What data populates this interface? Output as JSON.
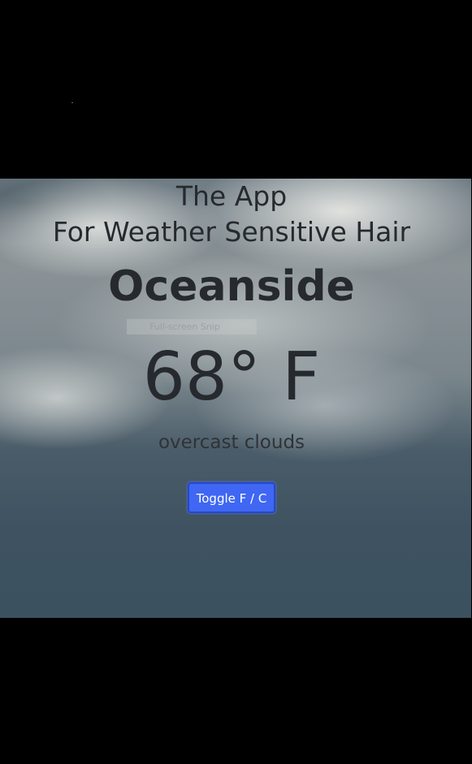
{
  "header": {
    "line1": "The App",
    "line2": "For Weather Sensitive Hair"
  },
  "weather": {
    "city": "Oceanside",
    "temperature": "68° F",
    "description": "overcast clouds"
  },
  "overlay": {
    "snip_text": "Full-screen Snip"
  },
  "controls": {
    "toggle_label": "Toggle F / C"
  },
  "colors": {
    "button": "#3f67f4",
    "text": "#262a2e",
    "background": "#000000"
  }
}
